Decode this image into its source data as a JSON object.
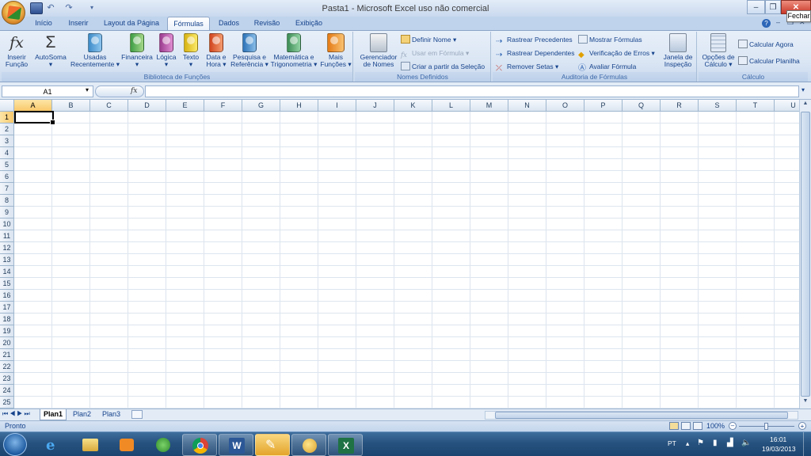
{
  "window": {
    "title": "Pasta1 - Microsoft Excel uso não comercial",
    "tooltip": "Fechar"
  },
  "tabs": [
    "Início",
    "Inserir",
    "Layout da Página",
    "Fórmulas",
    "Dados",
    "Revisão",
    "Exibição"
  ],
  "active_tab": "Fórmulas",
  "ribbon": {
    "biblioteca": {
      "label": "Biblioteca de Funções",
      "inserir_funcao": "Inserir Função",
      "autosoma": "AutoSoma",
      "usadas_recentemente": "Usadas Recentemente",
      "financeira": "Financeira",
      "logica": "Lógica",
      "texto": "Texto",
      "data_hora": "Data e Hora",
      "pesquisa_referencia": "Pesquisa e Referência",
      "matematica_trig": "Matemática e Trigonometria",
      "mais_funcoes": "Mais Funções"
    },
    "nomes": {
      "label": "Nomes Definidos",
      "gerenciador": "Gerenciador de Nomes",
      "definir_nome": "Definir Nome",
      "usar_em_formula": "Usar em Fórmula",
      "criar_selecao": "Criar a partir da Seleção"
    },
    "auditoria": {
      "label": "Auditoria de Fórmulas",
      "rastrear_precedentes": "Rastrear Precedentes",
      "rastrear_dependentes": "Rastrear Dependentes",
      "remover_setas": "Remover Setas",
      "mostrar_formulas": "Mostrar Fórmulas",
      "verificacao_erros": "Verificação de Erros",
      "avaliar_formula": "Avaliar Fórmula",
      "janela_inspecao": "Janela de Inspeção"
    },
    "calculo": {
      "label": "Cálculo",
      "opcoes_calculo": "Opções de Cálculo",
      "calcular_agora": "Calcular Agora",
      "calcular_planilha": "Calcular Planilha"
    }
  },
  "formula_bar": {
    "name_box": "A1",
    "fx_label": "fx",
    "value": ""
  },
  "columns": [
    "A",
    "B",
    "C",
    "D",
    "E",
    "F",
    "G",
    "H",
    "I",
    "J",
    "K",
    "L",
    "M",
    "N",
    "O",
    "P",
    "Q",
    "R",
    "S",
    "T",
    "U"
  ],
  "rows": [
    "1",
    "2",
    "3",
    "4",
    "5",
    "6",
    "7",
    "8",
    "9",
    "10",
    "11",
    "12",
    "13",
    "14",
    "15",
    "16",
    "17",
    "18",
    "19",
    "20",
    "21",
    "22",
    "23",
    "24",
    "25"
  ],
  "sheets": [
    "Plan1",
    "Plan2",
    "Plan3"
  ],
  "active_sheet": "Plan1",
  "status": {
    "text": "Pronto",
    "zoom": "100%"
  },
  "taskbar": {
    "language": "PT",
    "time": "16:01",
    "date": "19/03/2013"
  },
  "colors": {
    "ribbon_bg": "#dbe6f4",
    "tab_text": "#15428b",
    "taskbar": "#26527f",
    "selected_header": "#f8c86a"
  }
}
